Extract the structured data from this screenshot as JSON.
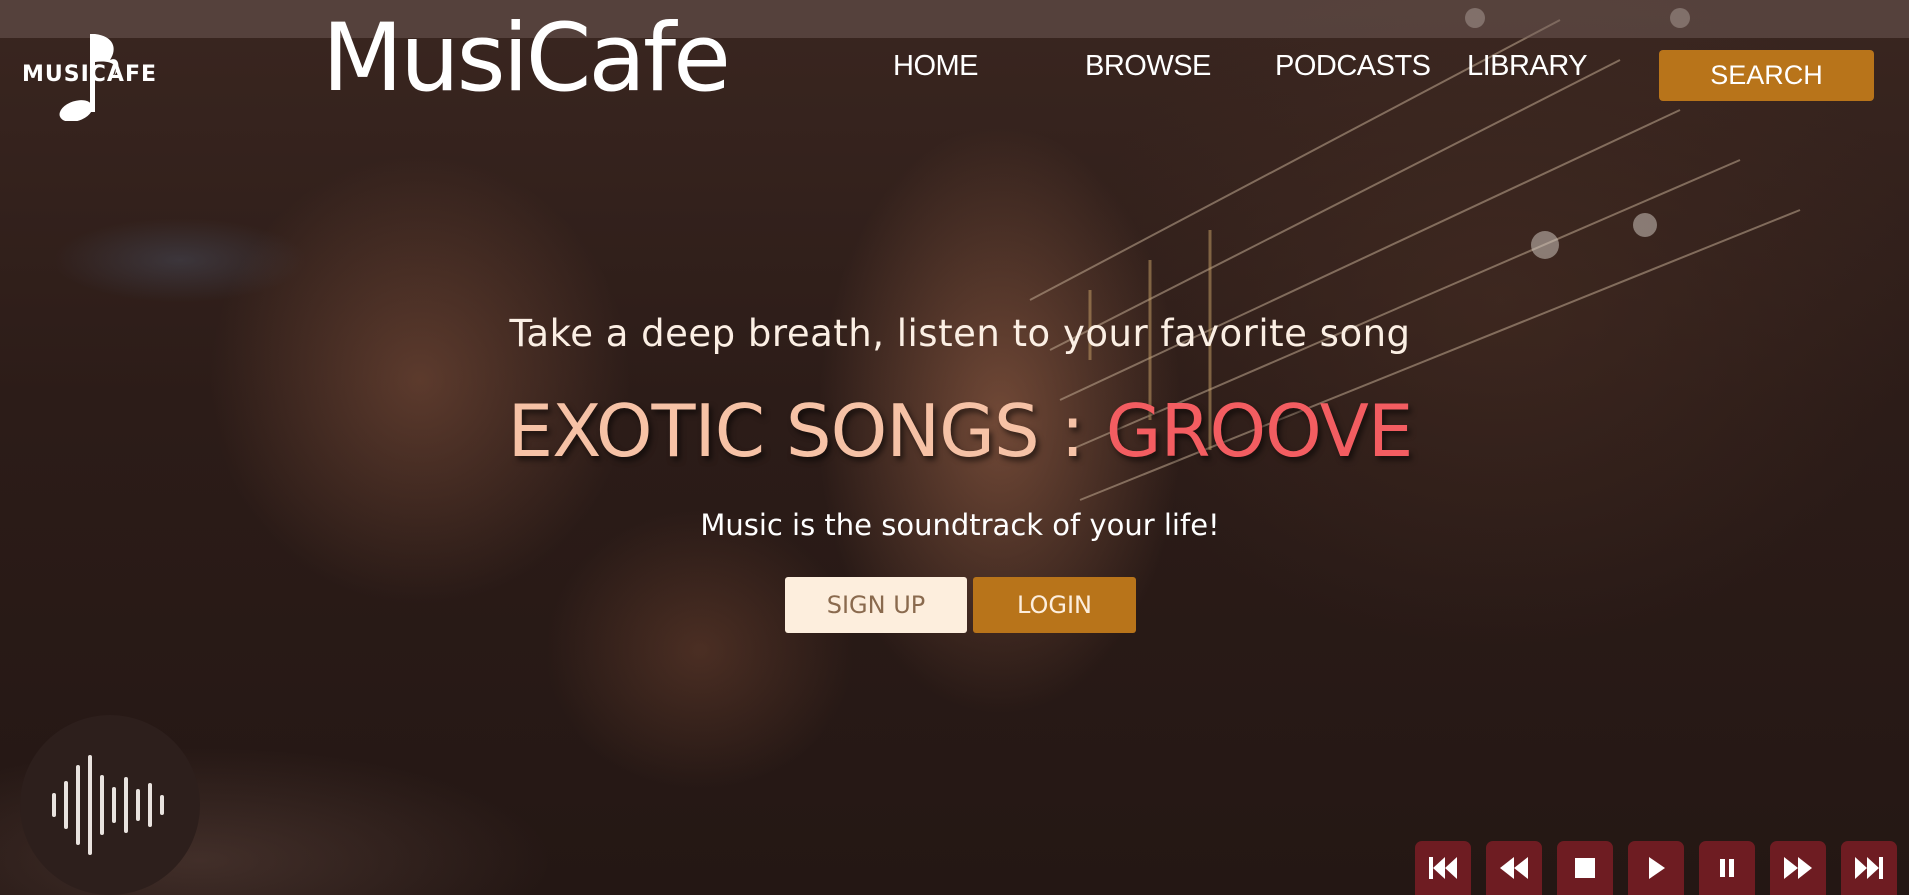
{
  "header": {
    "logo_text": "MUSICAFE",
    "wordmark": "MusiCafe",
    "nav": [
      {
        "label": "HOME"
      },
      {
        "label": "BROWSE"
      },
      {
        "label": "PODCASTS"
      },
      {
        "label": "LIBRARY"
      }
    ],
    "search_label": "SEARCH"
  },
  "hero": {
    "tagline": "Take a deep breath, listen to your favorite song",
    "headline_part1": "EXOTIC SONGS : ",
    "headline_part2": "GROOVE",
    "subtitle": "Music is the soundtrack of your life!",
    "signup_label": "SIGN UP",
    "login_label": "LOGIN"
  },
  "player": {
    "controls": [
      {
        "icon": "skip-to-start-icon"
      },
      {
        "icon": "rewind-icon"
      },
      {
        "icon": "stop-icon"
      },
      {
        "icon": "play-icon"
      },
      {
        "icon": "pause-icon"
      },
      {
        "icon": "fast-forward-icon"
      },
      {
        "icon": "skip-to-end-icon"
      }
    ]
  },
  "colors": {
    "accent": "#b8741a",
    "headline_light": "#f6c2a6",
    "headline_red": "#f35d61",
    "button_light": "#fdeedd",
    "player_button": "#6e1c22"
  }
}
